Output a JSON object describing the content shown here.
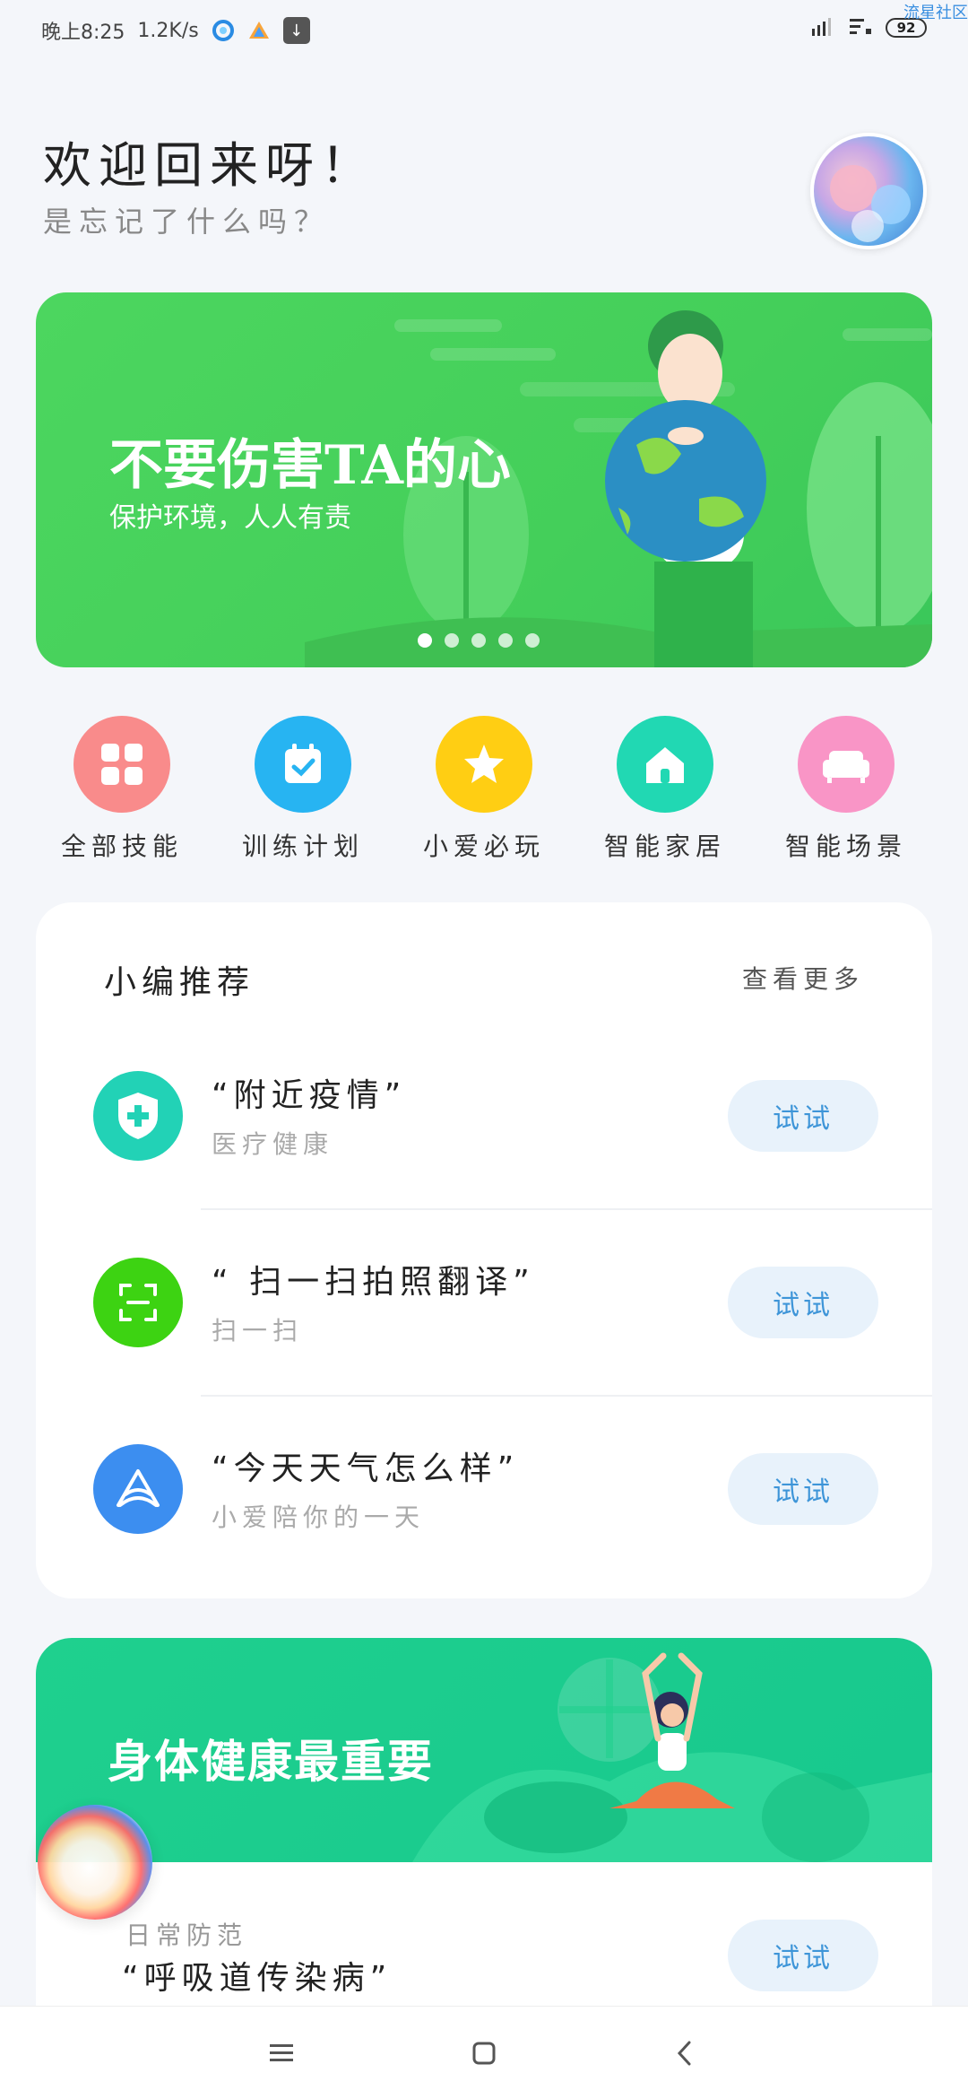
{
  "status_bar": {
    "time": "晚上8:25",
    "speed": "1.2K/s",
    "battery": "92",
    "corner_text": "流星社区"
  },
  "header": {
    "title": "欢迎回来呀！",
    "subtitle": "是忘记了什么吗？"
  },
  "banner1": {
    "title": "不要伤害TA的心",
    "subtitle": "保护环境，人人有责",
    "dots": 5
  },
  "quick_actions": [
    {
      "label": "全部技能",
      "color": "#f98b8b",
      "icon": "grid-icon"
    },
    {
      "label": "训练计划",
      "color": "#27b4f2",
      "icon": "calendar-check-icon"
    },
    {
      "label": "小爱必玩",
      "color": "#ffce13",
      "icon": "star-icon"
    },
    {
      "label": "智能家居",
      "color": "#21d8b3",
      "icon": "home-icon"
    },
    {
      "label": "智能场景",
      "color": "#f995c6",
      "icon": "sofa-icon"
    }
  ],
  "recommend": {
    "title": "小编推荐",
    "more": "查看更多",
    "items": [
      {
        "title": "“附近疫情”",
        "subtitle": "医疗健康",
        "button": "试试",
        "color": "#22d2b6",
        "icon": "medical-shield-icon"
      },
      {
        "title": "“ 扫一扫拍照翻译”",
        "subtitle": "扫一扫",
        "button": "试试",
        "color": "#3dd312",
        "icon": "scan-icon"
      },
      {
        "title": "“今天天气怎么样”",
        "subtitle": "小爱陪你的一天",
        "button": "试试",
        "color": "#3c8ef0",
        "icon": "xiaoai-logo-icon"
      }
    ]
  },
  "banner2": {
    "title": "身体健康最重要"
  },
  "bottom_card": {
    "kicker": "日常防范",
    "title": "“呼吸道传染病”",
    "button": "试试"
  }
}
